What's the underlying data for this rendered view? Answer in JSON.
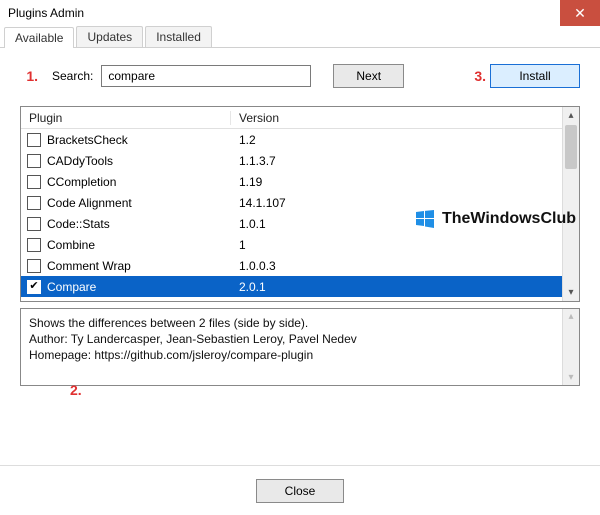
{
  "window": {
    "title": "Plugins Admin"
  },
  "tabs": {
    "available": "Available",
    "updates": "Updates",
    "installed": "Installed"
  },
  "callouts": {
    "one": "1.",
    "two": "2.",
    "three": "3."
  },
  "search": {
    "label": "Search:",
    "value": "compare",
    "next_label": "Next",
    "install_label": "Install"
  },
  "columns": {
    "plugin": "Plugin",
    "version": "Version"
  },
  "plugins": [
    {
      "name": "BracketsCheck",
      "version": "1.2",
      "checked": false,
      "selected": false
    },
    {
      "name": "CADdyTools",
      "version": "1.1.3.7",
      "checked": false,
      "selected": false
    },
    {
      "name": "CCompletion",
      "version": "1.19",
      "checked": false,
      "selected": false
    },
    {
      "name": "Code Alignment",
      "version": "14.1.107",
      "checked": false,
      "selected": false
    },
    {
      "name": "Code::Stats",
      "version": "1.0.1",
      "checked": false,
      "selected": false
    },
    {
      "name": "Combine",
      "version": "1",
      "checked": false,
      "selected": false
    },
    {
      "name": "Comment Wrap",
      "version": "1.0.0.3",
      "checked": false,
      "selected": false
    },
    {
      "name": "Compare",
      "version": "2.0.1",
      "checked": true,
      "selected": true
    }
  ],
  "description": {
    "line1": "Shows the differences between 2 files (side by side).",
    "line2": "Author: Ty Landercasper, Jean-Sebastien Leroy, Pavel Nedev",
    "line3": "Homepage: https://github.com/jsleroy/compare-plugin"
  },
  "buttons": {
    "close": "Close"
  },
  "watermark": {
    "text": "TheWindowsClub"
  }
}
